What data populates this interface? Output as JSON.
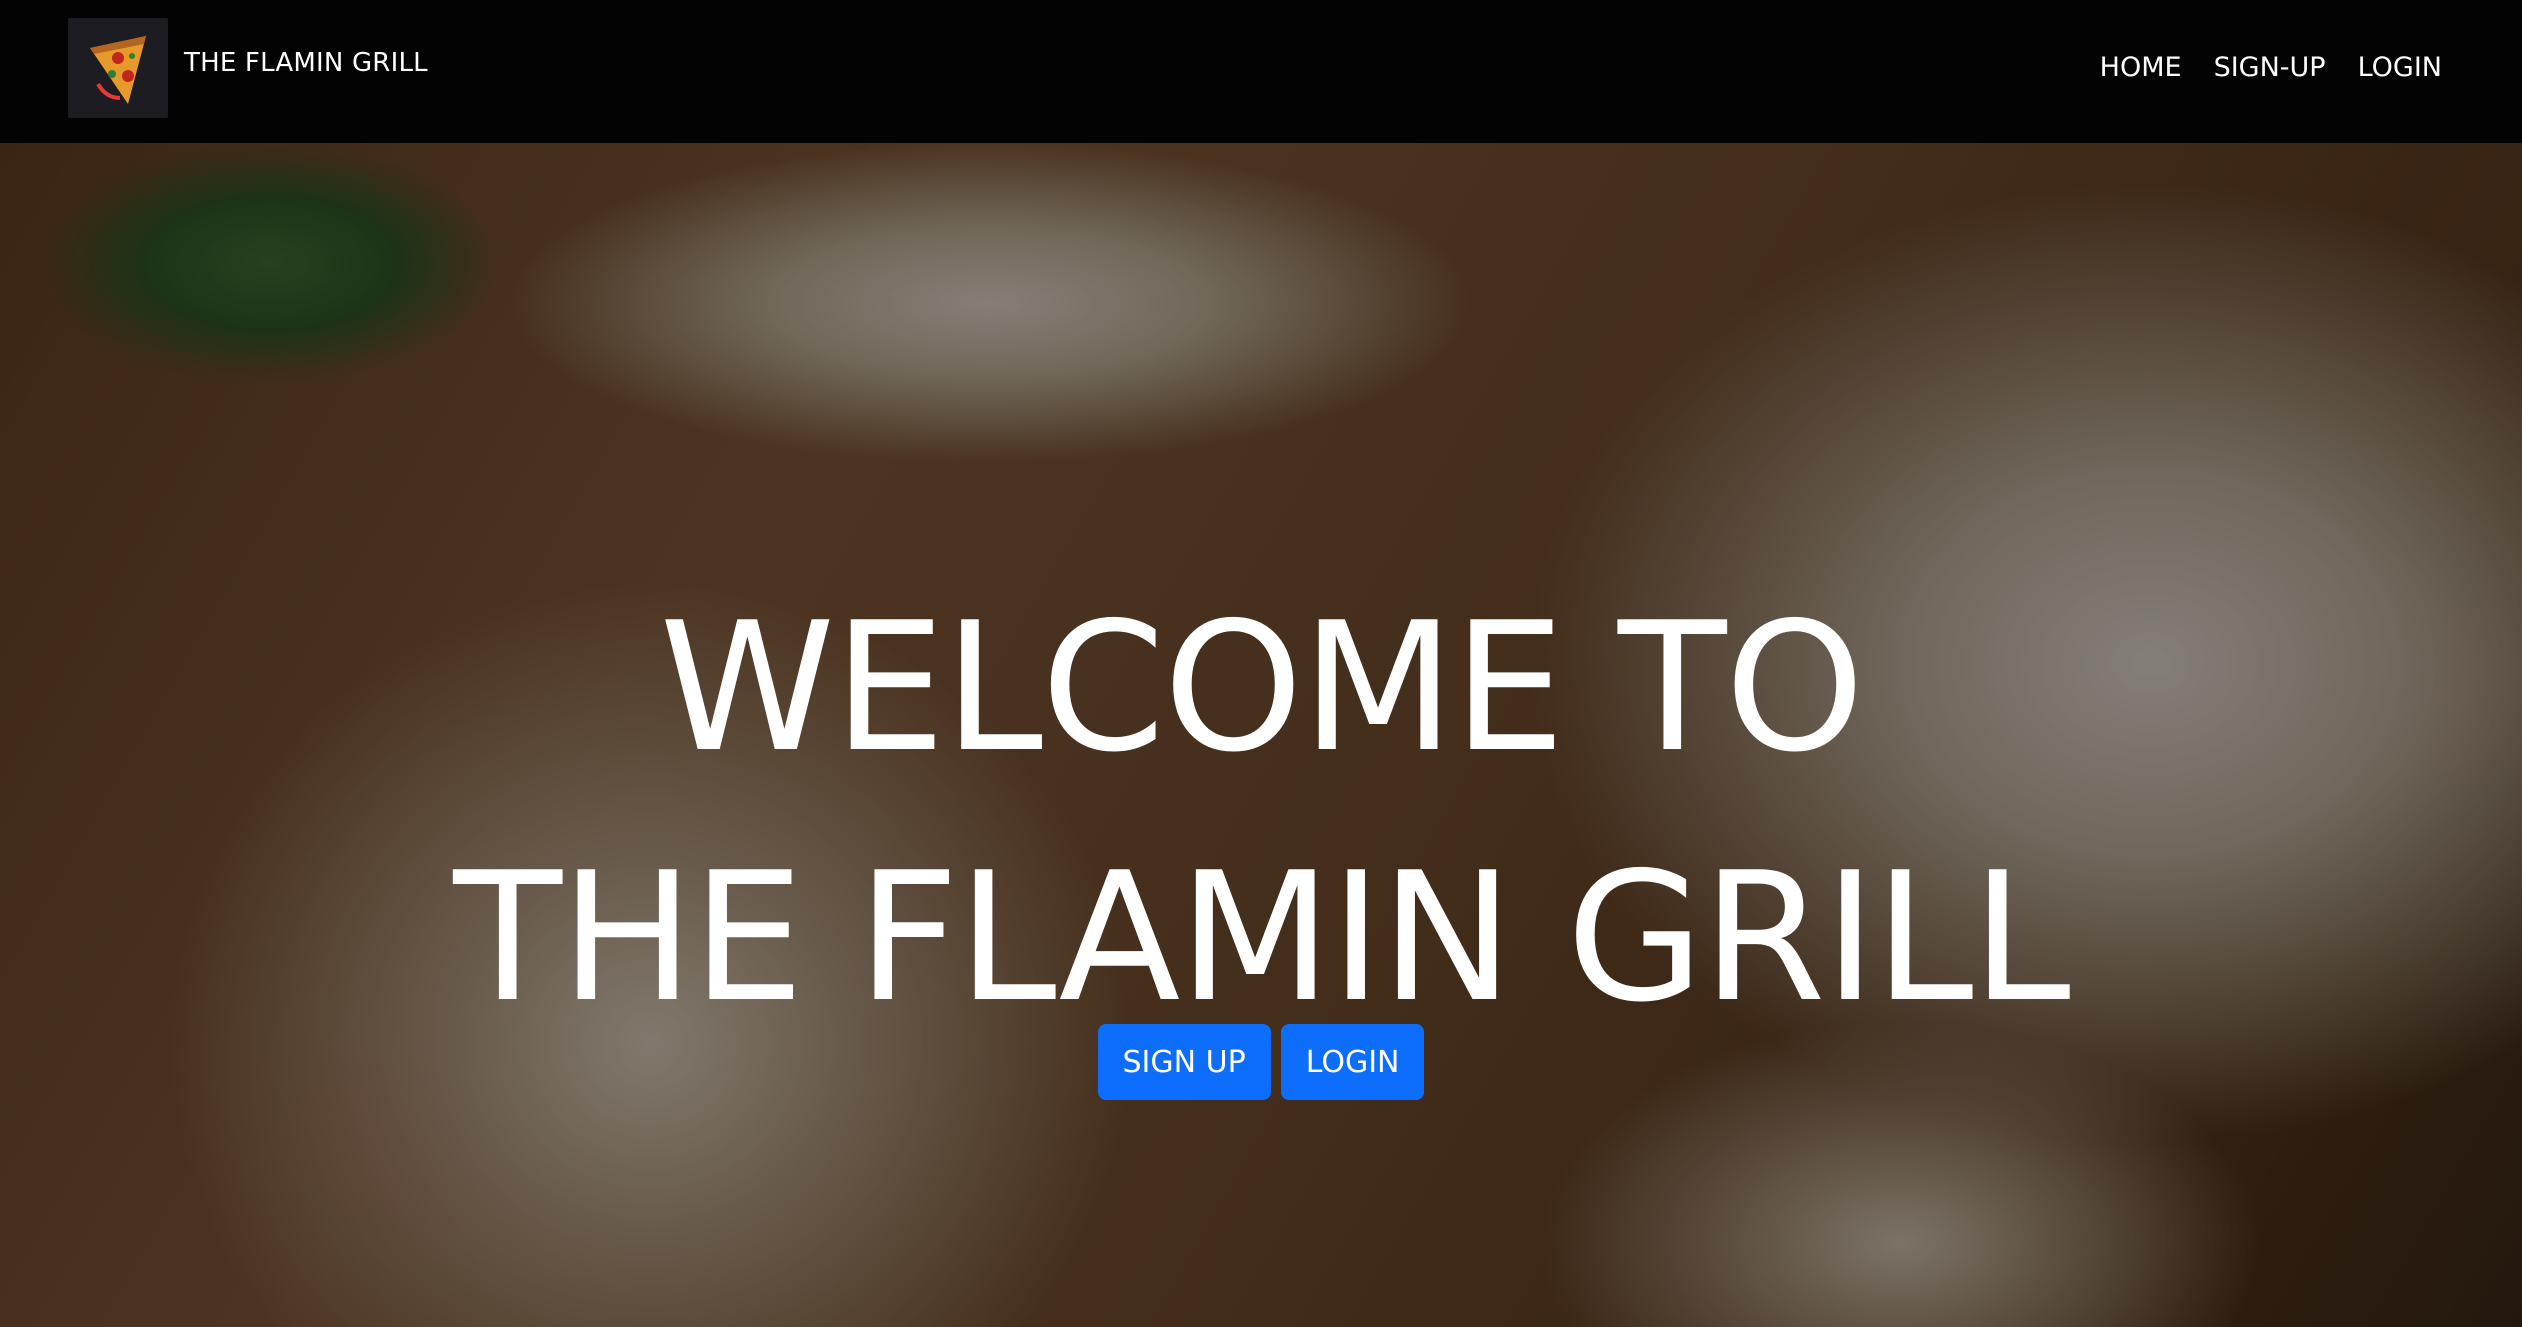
{
  "navbar": {
    "brand_name": "THE FLAMIN GRILL",
    "links": [
      {
        "label": "HOME"
      },
      {
        "label": "SIGN-UP"
      },
      {
        "label": "LOGIN"
      }
    ]
  },
  "hero": {
    "title_line1": "WELCOME TO",
    "title_line2": "THE FLAMIN GRILL",
    "signup_button": "SIGN UP",
    "login_button": "LOGIN"
  },
  "colors": {
    "navbar_bg": "#030303",
    "button_primary": "#0d6efd",
    "text": "#ffffff"
  },
  "icons": {
    "logo": "pizza-slice-logo-icon"
  }
}
